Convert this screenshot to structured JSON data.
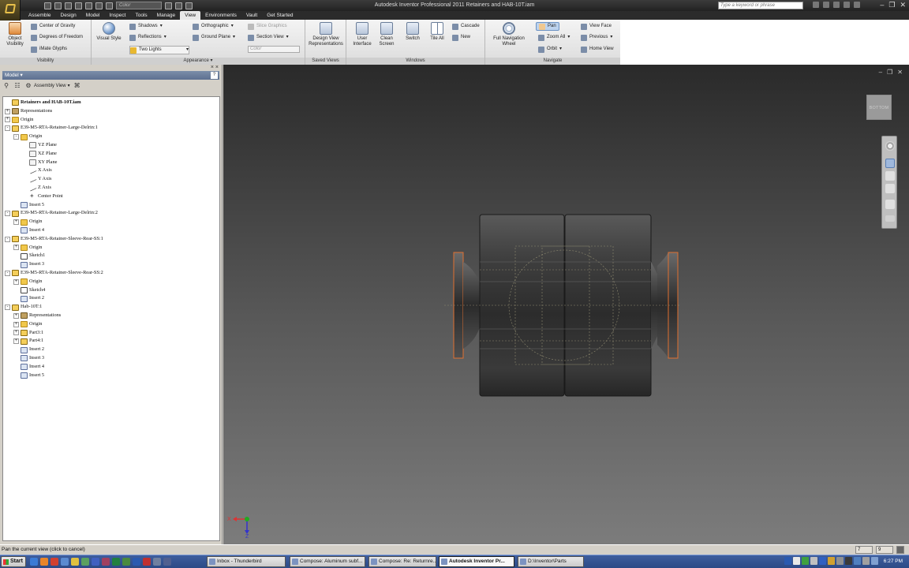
{
  "window": {
    "title": "Autodesk Inventor Professional 2011    Retainers and HAB-10T.iam",
    "search_placeholder": "Type a keyword or phrase",
    "qat_color_placeholder": "Color"
  },
  "ribbon": {
    "tabs": [
      "Assemble",
      "Design",
      "Model",
      "Inspect",
      "Tools",
      "Manage",
      "View",
      "Environments",
      "Vault",
      "Get Started"
    ],
    "active_tab": "View",
    "visibility": {
      "title": "Visibility",
      "object_visibility_line1": "Object",
      "object_visibility_line2": "Visibility",
      "center_of_gravity": "Center of Gravity",
      "degrees_of_freedom": "Degrees of Freedom",
      "mate_glyphs": "iMate Glyphs"
    },
    "appearance": {
      "title": "Appearance",
      "visual_style": "Visual Style",
      "shadows": "Shadows",
      "reflections": "Reflections",
      "two_lights": "Two Lights",
      "orthographic": "Orthographic",
      "ground_plane": "Ground Plane",
      "slice_graphics": "Slice Graphics",
      "section_view": "Section View",
      "color_placeholder": "Color"
    },
    "saved_views": {
      "title": "Saved Views",
      "design_view_line1": "Design View",
      "design_view_line2": "Representations"
    },
    "windows": {
      "title": "Windows",
      "user_interface_line1": "User",
      "user_interface_line2": "Interface",
      "clean_screen_line1": "Clean",
      "clean_screen_line2": "Screen",
      "switch": "Switch",
      "tile_all": "Tile All",
      "cascade": "Cascade",
      "new": "New"
    },
    "navigate": {
      "title": "Navigate",
      "full_nav_line1": "Full Navigation",
      "full_nav_line2": "Wheel",
      "pan": "Pan",
      "zoom_all": "Zoom All",
      "orbit": "Orbit",
      "view_face": "View Face",
      "previous": "Previous",
      "home_view": "Home View"
    }
  },
  "browser": {
    "header": "Model",
    "assembly_view": "Assembly View",
    "tree": [
      {
        "label": "Retainers and HAB-10T.iam",
        "level": 0,
        "icon": "part",
        "bold": true,
        "exp": ""
      },
      {
        "label": "Representations",
        "level": 0,
        "icon": "reps",
        "exp": "+"
      },
      {
        "label": "Origin",
        "level": 0,
        "icon": "folder",
        "exp": "+"
      },
      {
        "label": "E39-M5-RTA-Retainer-Large-Delrin:1",
        "level": 0,
        "icon": "part",
        "exp": "-"
      },
      {
        "label": "Origin",
        "level": 1,
        "icon": "folder",
        "exp": "-"
      },
      {
        "label": "YZ Plane",
        "level": 2,
        "icon": "plane",
        "exp": ""
      },
      {
        "label": "XZ Plane",
        "level": 2,
        "icon": "plane",
        "exp": ""
      },
      {
        "label": "XY Plane",
        "level": 2,
        "icon": "plane",
        "exp": ""
      },
      {
        "label": "X Axis",
        "level": 2,
        "icon": "axis",
        "exp": ""
      },
      {
        "label": "Y Axis",
        "level": 2,
        "icon": "axis",
        "exp": ""
      },
      {
        "label": "Z Axis",
        "level": 2,
        "icon": "axis",
        "exp": ""
      },
      {
        "label": "Center Point",
        "level": 2,
        "icon": "point",
        "exp": ""
      },
      {
        "label": "Insert 5",
        "level": 1,
        "icon": "constraint",
        "exp": ""
      },
      {
        "label": "E39-M5-RTA-Retainer-Large-Delrin:2",
        "level": 0,
        "icon": "part",
        "exp": "-"
      },
      {
        "label": "Origin",
        "level": 1,
        "icon": "folder",
        "exp": "+"
      },
      {
        "label": "Insert 4",
        "level": 1,
        "icon": "constraint",
        "exp": ""
      },
      {
        "label": "E39-M5-RTA-Retainer-Sleeve-Rear-SS:1",
        "level": 0,
        "icon": "part",
        "exp": "-"
      },
      {
        "label": "Origin",
        "level": 1,
        "icon": "folder",
        "exp": "+"
      },
      {
        "label": "Sketch1",
        "level": 1,
        "icon": "sketch",
        "exp": ""
      },
      {
        "label": "Insert 3",
        "level": 1,
        "icon": "constraint",
        "exp": ""
      },
      {
        "label": "E39-M5-RTA-Retainer-Sleeve-Rear-SS:2",
        "level": 0,
        "icon": "part",
        "exp": "-"
      },
      {
        "label": "Origin",
        "level": 1,
        "icon": "folder",
        "exp": "+"
      },
      {
        "label": "Sketch4",
        "level": 1,
        "icon": "sketch",
        "exp": ""
      },
      {
        "label": "Insert 2",
        "level": 1,
        "icon": "constraint",
        "exp": ""
      },
      {
        "label": "Hab-10T:1",
        "level": 0,
        "icon": "part",
        "exp": "-"
      },
      {
        "label": "Representations",
        "level": 1,
        "icon": "reps",
        "exp": "+"
      },
      {
        "label": "Origin",
        "level": 1,
        "icon": "folder",
        "exp": "+"
      },
      {
        "label": "Part3:1",
        "level": 1,
        "icon": "part",
        "exp": "+"
      },
      {
        "label": "Part4:1",
        "level": 1,
        "icon": "part",
        "exp": "+"
      },
      {
        "label": "Insert 2",
        "level": 1,
        "icon": "constraint",
        "exp": ""
      },
      {
        "label": "Insert 3",
        "level": 1,
        "icon": "constraint",
        "exp": ""
      },
      {
        "label": "Insert 4",
        "level": 1,
        "icon": "constraint",
        "exp": ""
      },
      {
        "label": "Insert 5",
        "level": 1,
        "icon": "constraint",
        "exp": ""
      }
    ]
  },
  "viewport": {
    "viewcube_label": "BOTTOM",
    "triad_x": "X",
    "triad_z": "Z"
  },
  "status": {
    "message": "Pan the current view (click to cancel)",
    "num1": "7",
    "num2": "9"
  },
  "taskbar": {
    "start": "Start",
    "tasks": [
      {
        "label": "Inbox - Thunderbird",
        "active": false
      },
      {
        "label": "Compose: Aluminum subf...",
        "active": false
      },
      {
        "label": "Compose: Re: Returnre...",
        "active": false
      },
      {
        "label": "Autodesk Inventor Pr...",
        "active": true
      },
      {
        "label": "D:\\Inventor\\Parts",
        "active": false
      }
    ],
    "clock": "6:27 PM"
  },
  "colors": {
    "viewport_top": "#2a2a2a",
    "viewport_bottom": "#7c7c7c",
    "ribbon_active_tab": "#e8e8e8",
    "model_body": "#3a3a3a",
    "flange_edge": "#e07030"
  }
}
